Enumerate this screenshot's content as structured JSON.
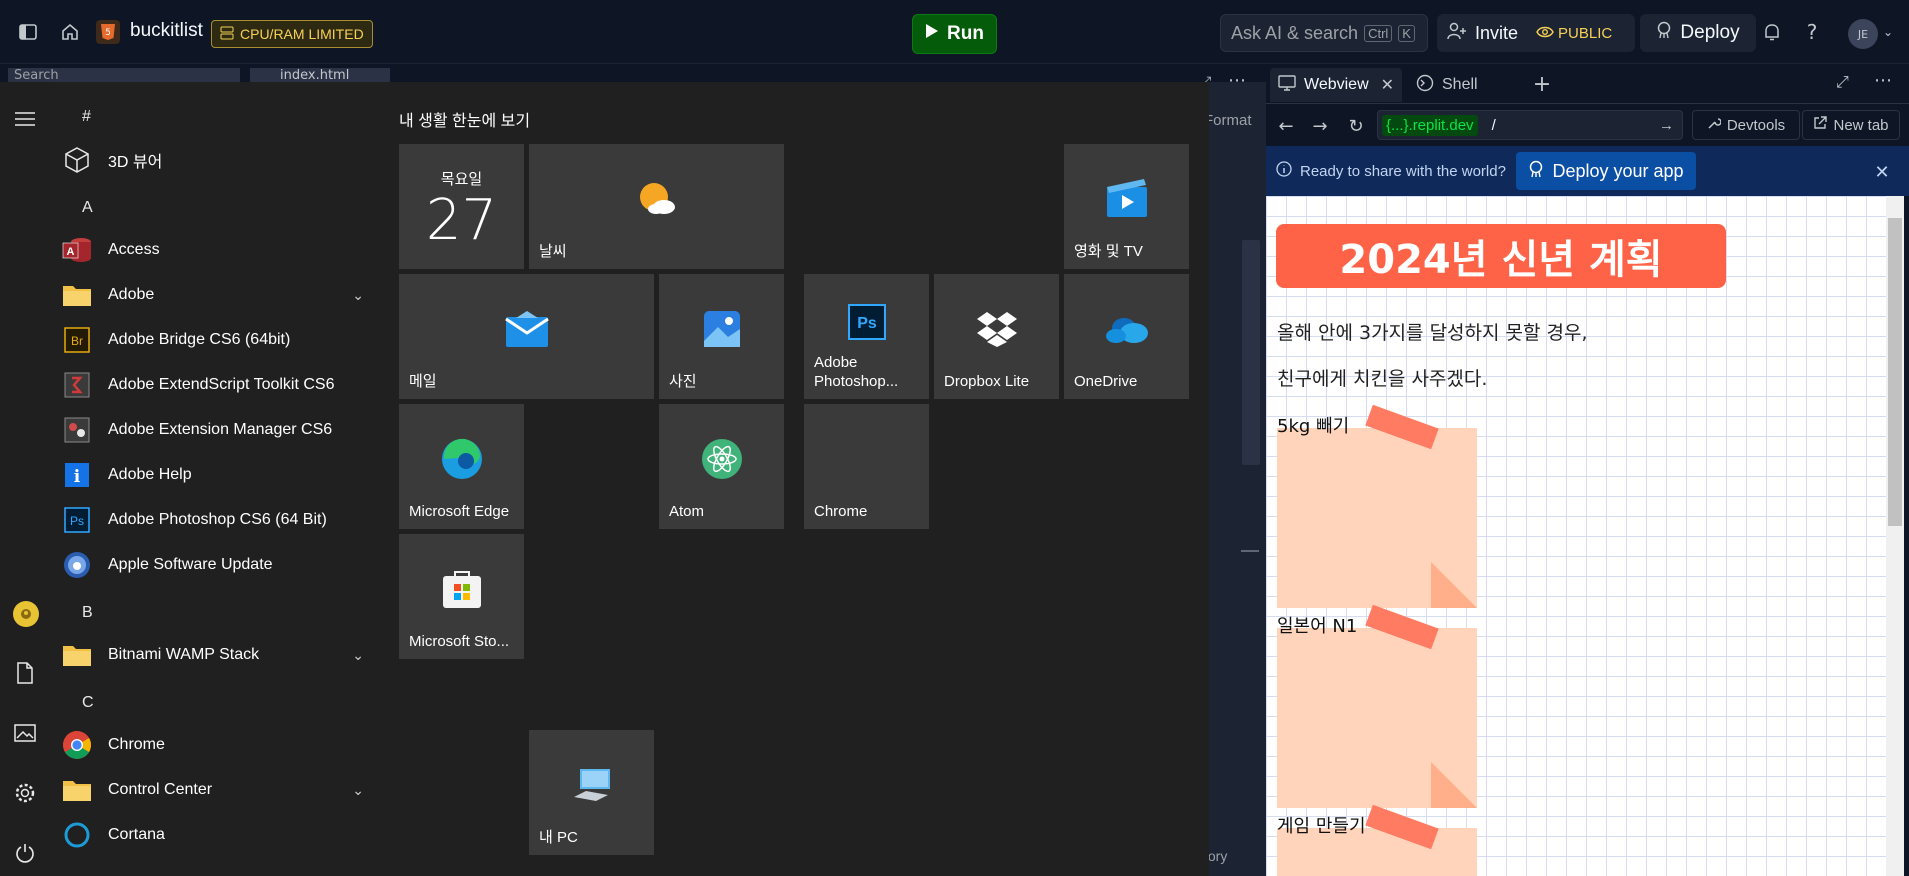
{
  "topbar": {
    "repl_name": "buckitlist",
    "resource_badge": "CPU/RAM LIMITED",
    "run_label": "Run",
    "search_placeholder": "Ask AI & search",
    "shortcut_ctrl": "Ctrl",
    "shortcut_key": "K",
    "invite_label": "Invite",
    "visibility_label": "PUBLIC",
    "deploy_label": "Deploy",
    "avatar_initials": "JE"
  },
  "editor_bg": {
    "search_text": "Search",
    "file_tab": "index.html",
    "format_label": "Format",
    "history_label": "tory"
  },
  "start_menu": {
    "tiles_group_title": "내 생활 한눈에 보기",
    "app_list": [
      {
        "kind": "letter",
        "text": "#"
      },
      {
        "kind": "app",
        "text": "3D 뷰어",
        "icon": "cube-icon"
      },
      {
        "kind": "letter",
        "text": "A"
      },
      {
        "kind": "app",
        "text": "Access",
        "icon": "access-icon"
      },
      {
        "kind": "folder",
        "text": "Adobe",
        "icon": "folder-icon"
      },
      {
        "kind": "app",
        "text": "Adobe Bridge CS6 (64bit)",
        "icon": "bridge-icon"
      },
      {
        "kind": "app",
        "text": "Adobe ExtendScript Toolkit CS6",
        "icon": "extendscript-icon"
      },
      {
        "kind": "app",
        "text": "Adobe Extension Manager CS6",
        "icon": "extension-manager-icon"
      },
      {
        "kind": "app",
        "text": "Adobe Help",
        "icon": "help-icon"
      },
      {
        "kind": "app",
        "text": "Adobe Photoshop CS6 (64 Bit)",
        "icon": "photoshop-icon"
      },
      {
        "kind": "app",
        "text": "Apple Software Update",
        "icon": "apple-update-icon"
      },
      {
        "kind": "letter",
        "text": "B"
      },
      {
        "kind": "folder",
        "text": "Bitnami WAMP Stack",
        "icon": "folder-icon"
      },
      {
        "kind": "letter",
        "text": "C"
      },
      {
        "kind": "app",
        "text": "Chrome",
        "icon": "chrome-icon"
      },
      {
        "kind": "folder",
        "text": "Control Center",
        "icon": "folder-icon"
      },
      {
        "kind": "app",
        "text": "Cortana",
        "icon": "cortana-icon"
      }
    ],
    "tiles": {
      "calendar_day": "목요일",
      "calendar_date": "27",
      "weather": "날씨",
      "movies": "영화 및 TV",
      "mail": "메일",
      "photos": "사진",
      "photoshop": "Adobe Photoshop...",
      "dropbox": "Dropbox Lite",
      "onedrive": "OneDrive",
      "edge": "Microsoft Edge",
      "atom": "Atom",
      "chrome": "Chrome",
      "store": "Microsoft Sto...",
      "mypc": "내 PC"
    }
  },
  "webview": {
    "tab_webview": "Webview",
    "tab_shell": "Shell",
    "url_host": "{...}.replit.dev",
    "url_path": "/",
    "devtools_label": "Devtools",
    "newtab_label": "New tab",
    "banner_text": "Ready to share with the world?",
    "banner_button": "Deploy your app",
    "page": {
      "title": "2024년 신년 계획",
      "line1": "올해 안에 3가지를 달성하지 못할 경우,",
      "line2": "친구에게 치킨을 사주겠다.",
      "goals": [
        "5kg 빼기",
        "일본어 N1",
        "게임 만들기"
      ]
    }
  },
  "colors": {
    "run_green": "#045b09",
    "title_tomato": "#ff6347",
    "note_peach": "#ffd4bb",
    "banner_blue": "#0f2a5a"
  }
}
